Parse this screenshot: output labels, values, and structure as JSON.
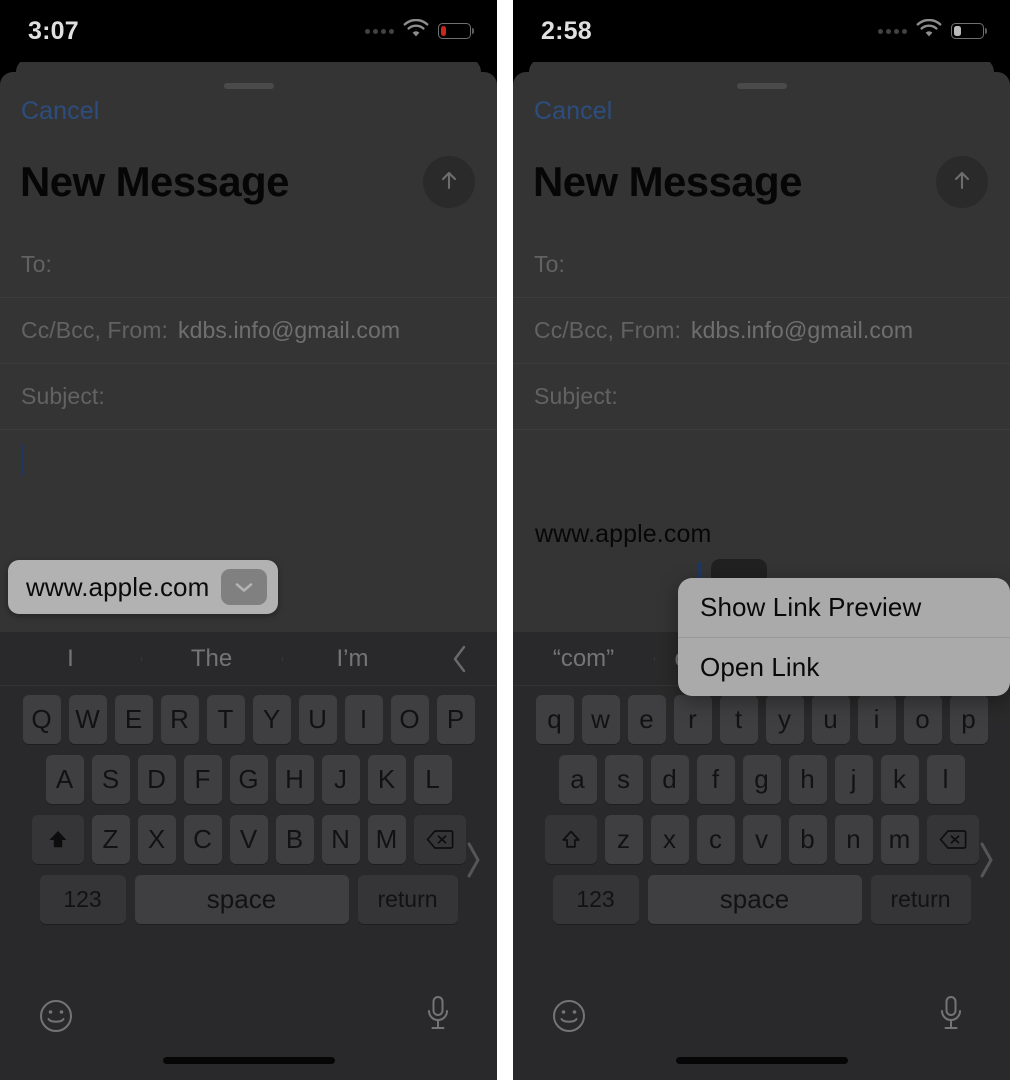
{
  "panels": [
    {
      "id": "left",
      "status": {
        "time": "3:07",
        "wifi_icon": "wifi-icon",
        "battery_icon": "battery-low-icon",
        "signal_icon": "signal-dots-icon"
      },
      "sheet": {
        "cancel_label": "Cancel",
        "title": "New Message",
        "send_icon": "send-arrow-up-icon",
        "fields": [
          {
            "name": "to",
            "label": "To:",
            "value": ""
          },
          {
            "name": "ccbcc-from",
            "label": "Cc/Bcc, From:",
            "value": "kdbs.info@gmail.com"
          },
          {
            "name": "subject",
            "label": "Subject:",
            "value": ""
          }
        ],
        "body_text": ""
      },
      "url_pill": {
        "visible": true,
        "url": "www.apple.com",
        "chevron_icon": "chevron-down-icon"
      },
      "context_menu": {
        "visible": false,
        "items": []
      },
      "keyboard": {
        "suggestions": [
          "I",
          "The",
          "I’m"
        ],
        "more_icon": "chevron-left-icon",
        "shift_state": "active",
        "shift_icon": "shift-filled-icon",
        "row1": [
          "Q",
          "W",
          "E",
          "R",
          "T",
          "Y",
          "U",
          "I",
          "O",
          "P"
        ],
        "row2": [
          "A",
          "S",
          "D",
          "F",
          "G",
          "H",
          "J",
          "K",
          "L"
        ],
        "row3": [
          "Z",
          "X",
          "C",
          "V",
          "B",
          "N",
          "M"
        ],
        "backspace_icon": "backspace-icon",
        "numeric_label": "123",
        "space_label": "space",
        "return_label": "return",
        "emoji_icon": "emoji-smiley-icon",
        "mic_icon": "microphone-icon",
        "edge_icon": "chevron-right-icon"
      }
    },
    {
      "id": "right",
      "status": {
        "time": "2:58",
        "wifi_icon": "wifi-icon",
        "battery_icon": "battery-mid-icon",
        "signal_icon": "signal-dots-icon"
      },
      "sheet": {
        "cancel_label": "Cancel",
        "title": "New Message",
        "send_icon": "send-arrow-up-icon",
        "fields": [
          {
            "name": "to",
            "label": "To:",
            "value": ""
          },
          {
            "name": "ccbcc-from",
            "label": "Cc/Bcc, From:",
            "value": "kdbs.info@gmail.com"
          },
          {
            "name": "subject",
            "label": "Subject:",
            "value": ""
          }
        ],
        "body_text": "www.apple.com"
      },
      "url_pill": {
        "visible": false,
        "url": "",
        "chevron_icon": ""
      },
      "context_menu": {
        "visible": true,
        "items": [
          {
            "name": "show-link-preview",
            "label": "Show Link Preview"
          },
          {
            "name": "open-link",
            "label": "Open Link"
          }
        ]
      },
      "keyboard": {
        "suggestions": [
          "“com”",
          "computer"
        ],
        "more_icon": "chevron-left-icon",
        "shift_state": "inactive",
        "shift_icon": "shift-outline-icon",
        "row1": [
          "q",
          "w",
          "e",
          "r",
          "t",
          "y",
          "u",
          "i",
          "o",
          "p"
        ],
        "row2": [
          "a",
          "s",
          "d",
          "f",
          "g",
          "h",
          "j",
          "k",
          "l"
        ],
        "row3": [
          "z",
          "x",
          "c",
          "v",
          "b",
          "n",
          "m"
        ],
        "backspace_icon": "backspace-icon",
        "numeric_label": "123",
        "space_label": "space",
        "return_label": "return",
        "emoji_icon": "emoji-smiley-icon",
        "mic_icon": "microphone-icon",
        "edge_icon": "chevron-right-icon"
      }
    }
  ],
  "colors": {
    "accent_blue": "#3f6fb5",
    "caret_blue": "#2d4f8a",
    "battery_low_red": "#e02b20",
    "sheet_bg": "#4b4b4b",
    "keyboard_bg": "#3c3c3e",
    "key_bg": "#5b5b5e",
    "menu_bg": "#f4f4f4"
  }
}
